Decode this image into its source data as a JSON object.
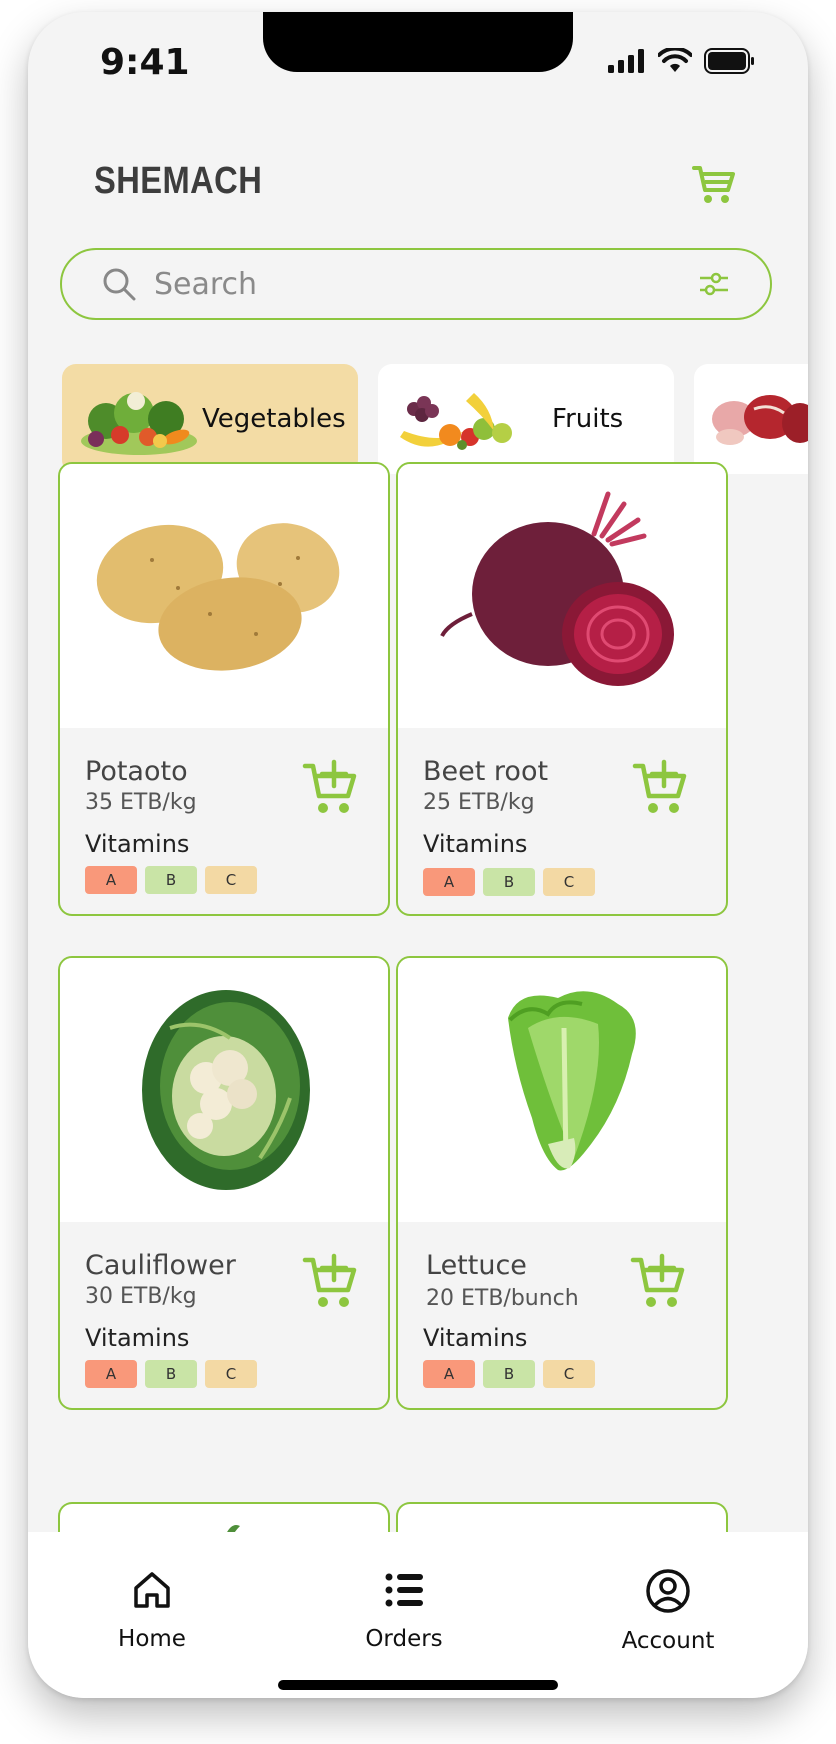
{
  "status_bar": {
    "time": "9:41"
  },
  "header": {
    "title": "SHEMACH"
  },
  "search": {
    "placeholder": "Search"
  },
  "categories": [
    {
      "label": "Vegetables",
      "active": true
    },
    {
      "label": "Fruits",
      "active": false
    }
  ],
  "products": [
    {
      "name": "Potaoto",
      "price": "35 ETB/kg",
      "vitamins_label": "Vitamins",
      "vitamins": [
        "A",
        "B",
        "C"
      ]
    },
    {
      "name": "Beet root",
      "price": "25 ETB/kg",
      "vitamins_label": "Vitamins",
      "vitamins": [
        "A",
        "B",
        "C"
      ]
    },
    {
      "name": "Cauliflower",
      "price": "30 ETB/kg",
      "vitamins_label": "Vitamins",
      "vitamins": [
        "A",
        "B",
        "C"
      ]
    },
    {
      "name": "Lettuce",
      "price": "20 ETB/bunch",
      "vitamins_label": "Vitamins",
      "vitamins": [
        "A",
        "B",
        "C"
      ]
    }
  ],
  "bottom_nav": [
    {
      "label": "Home",
      "icon": "home-icon"
    },
    {
      "label": "Orders",
      "icon": "list-icon"
    },
    {
      "label": "Account",
      "icon": "account-icon"
    }
  ],
  "colors": {
    "accent": "#8dc63f",
    "active_category": "#f3dca5",
    "vitamin_a": "#f9987a",
    "vitamin_b": "#c9e4a6",
    "vitamin_c": "#f3d9a4"
  }
}
